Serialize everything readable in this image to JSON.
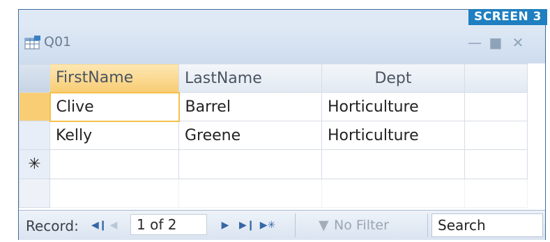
{
  "badge": "SCREEN 3",
  "window": {
    "title": "Q01"
  },
  "grid": {
    "columns": [
      "FirstName",
      "LastName",
      "Dept"
    ],
    "rows": [
      [
        "Clive",
        "Barrel",
        "Horticulture"
      ],
      [
        "Kelly",
        "Greene",
        "Horticulture"
      ]
    ],
    "new_row_marker": "✳"
  },
  "navigation": {
    "label": "Record:",
    "position": "1 of 2",
    "filter": "No Filter",
    "search": "Search"
  },
  "colors": {
    "accent": "#1f7fc0",
    "selection": "#f8cc73"
  }
}
